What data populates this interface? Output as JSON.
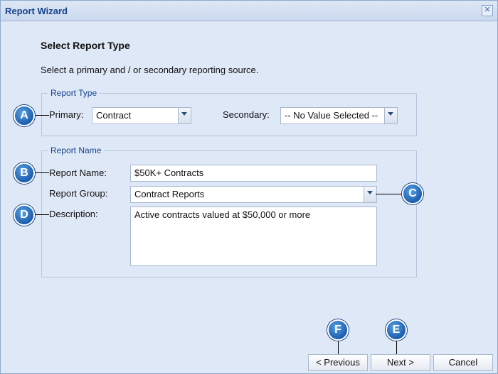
{
  "window": {
    "title": "Report Wizard",
    "close_glyph": "✕"
  },
  "page": {
    "heading": "Select Report Type",
    "subtext": "Select a primary and / or secondary reporting source."
  },
  "report_type": {
    "legend": "Report Type",
    "primary_label": "Primary:",
    "primary_value": "Contract",
    "secondary_label": "Secondary:",
    "secondary_value": "-- No Value Selected --"
  },
  "report_name": {
    "legend": "Report Name",
    "name_label": "Report Name:",
    "name_value": "$50K+ Contracts",
    "group_label": "Report Group:",
    "group_value": "Contract Reports",
    "description_label": "Description:",
    "description_value": "Active contracts valued at $50,000 or more"
  },
  "markers": {
    "a": "A",
    "b": "B",
    "c": "C",
    "d": "D",
    "e": "E",
    "f": "F"
  },
  "buttons": {
    "previous": "< Previous",
    "next": "Next >",
    "cancel": "Cancel"
  },
  "icons": {
    "close": "close-icon",
    "dropdown": "chevron-down-icon"
  }
}
